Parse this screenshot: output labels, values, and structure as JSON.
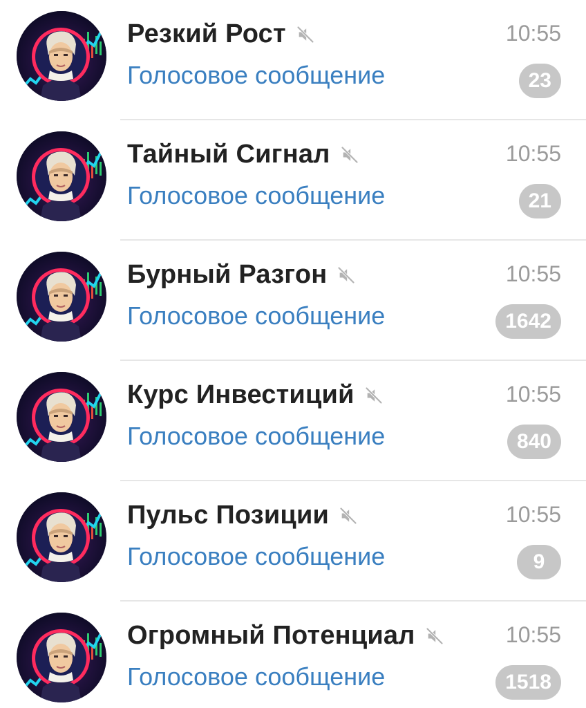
{
  "chats": [
    {
      "title": "Резкий Рост",
      "time": "10:55",
      "preview": "Голосовое сообщение",
      "unread": "23",
      "muted": true
    },
    {
      "title": "Тайный Сигнал",
      "time": "10:55",
      "preview": "Голосовое сообщение",
      "unread": "21",
      "muted": true
    },
    {
      "title": "Бурный Разгон",
      "time": "10:55",
      "preview": "Голосовое сообщение",
      "unread": "1642",
      "muted": true
    },
    {
      "title": "Курс Инвестиций",
      "time": "10:55",
      "preview": "Голосовое сообщение",
      "unread": "840",
      "muted": true
    },
    {
      "title": "Пульс Позиции",
      "time": "10:55",
      "preview": "Голосовое сообщение",
      "unread": "9",
      "muted": true
    },
    {
      "title": "Огромный Потенциал",
      "time": "10:55",
      "preview": "Голосовое сообщение",
      "unread": "1518",
      "muted": true
    }
  ],
  "icons": {
    "mute": "muted-speaker-icon",
    "avatar": "portrait-avatar"
  },
  "colors": {
    "title": "#222222",
    "preview": "#3a7fc0",
    "time": "#9a9a9a",
    "badge": "#c7c7c7",
    "badge_text": "#ffffff",
    "divider": "#e6e6e6"
  }
}
